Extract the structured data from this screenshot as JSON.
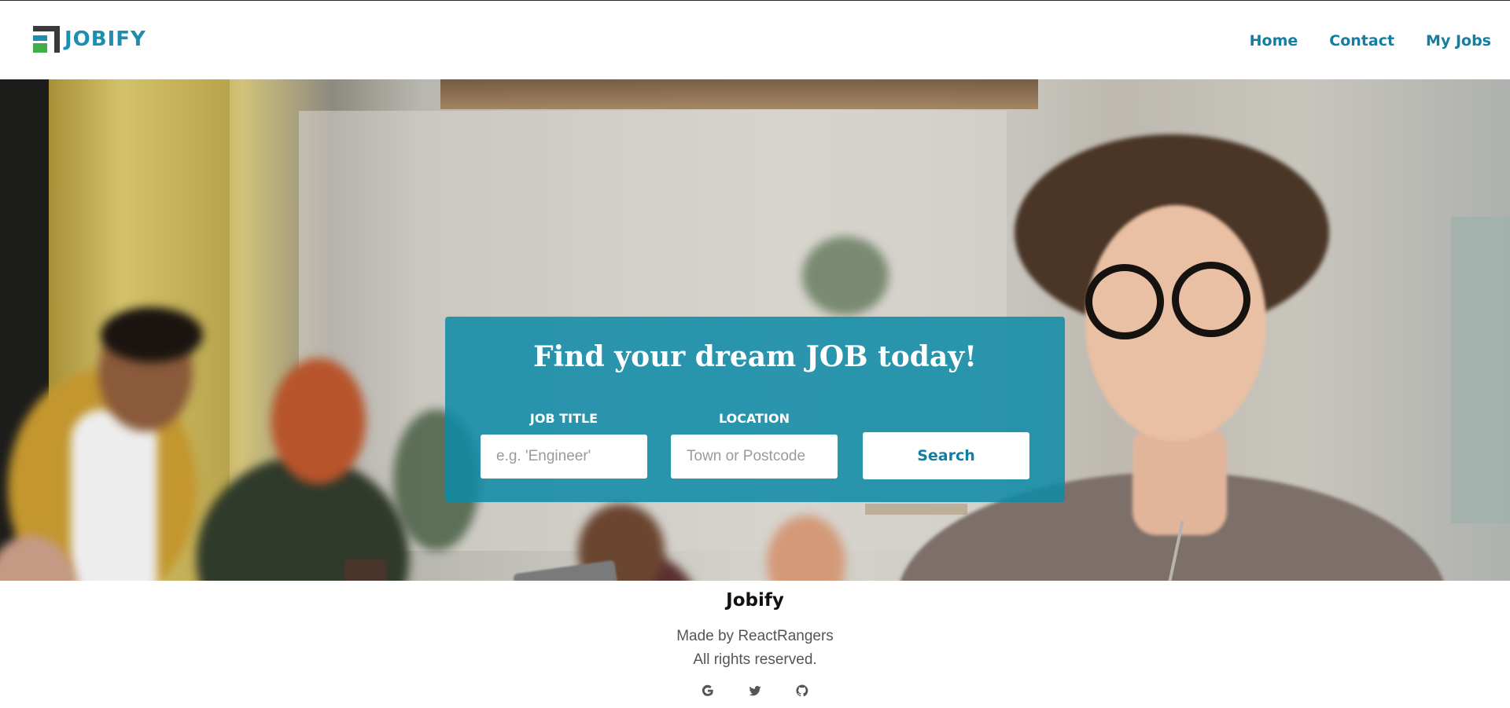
{
  "app": {
    "brand": "JOBIFY",
    "logo_icon": "jobify-logo-icon"
  },
  "nav": {
    "items": [
      {
        "label": "Home"
      },
      {
        "label": "Contact"
      },
      {
        "label": "My Jobs"
      }
    ]
  },
  "hero": {
    "title": "Find your dream JOB today!",
    "job_title_label": "JOB TITLE",
    "job_title_placeholder": "e.g. 'Engineer'",
    "location_label": "LOCATION",
    "location_placeholder": "Town or Postcode",
    "search_label": "Search"
  },
  "footer": {
    "brand": "Jobify",
    "made_by": "Made by ReactRangers",
    "rights": "All rights reserved.",
    "social_icons": [
      "google-icon",
      "twitter-icon",
      "github-icon"
    ]
  },
  "colors": {
    "accent": "#137ea3",
    "card": "#0d8aa6",
    "logo_green": "#3fae49",
    "logo_dark": "#3a3a3a"
  }
}
